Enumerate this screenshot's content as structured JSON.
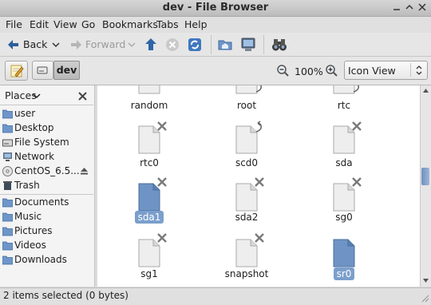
{
  "window": {
    "title": "dev - File Browser"
  },
  "menubar": {
    "items": [
      "File",
      "Edit",
      "View",
      "Go",
      "Bookmarks",
      "Tabs",
      "Help"
    ]
  },
  "toolbar": {
    "back_label": "Back",
    "forward_label": "Forward"
  },
  "location": {
    "crumb": "dev",
    "zoom": "100%",
    "view_mode": "Icon View"
  },
  "sidebar": {
    "header": "Places",
    "places": [
      "user",
      "Desktop",
      "File System",
      "Network",
      "CentOS_6.5...",
      "Trash"
    ],
    "bookmarks": [
      "Documents",
      "Music",
      "Pictures",
      "Videos",
      "Downloads"
    ]
  },
  "files": [
    {
      "name": "random"
    },
    {
      "name": "root"
    },
    {
      "name": "rtc"
    },
    {
      "name": "rtc0"
    },
    {
      "name": "scd0"
    },
    {
      "name": "sda"
    },
    {
      "name": "sda1"
    },
    {
      "name": "sda2"
    },
    {
      "name": "sg0"
    },
    {
      "name": "sg1"
    },
    {
      "name": "snapshot"
    },
    {
      "name": "sr0"
    }
  ],
  "status": {
    "text": "2 items selected (0 bytes)"
  },
  "colors": {
    "selection": "#7b9fcc",
    "accent": "#4a7bb8"
  }
}
